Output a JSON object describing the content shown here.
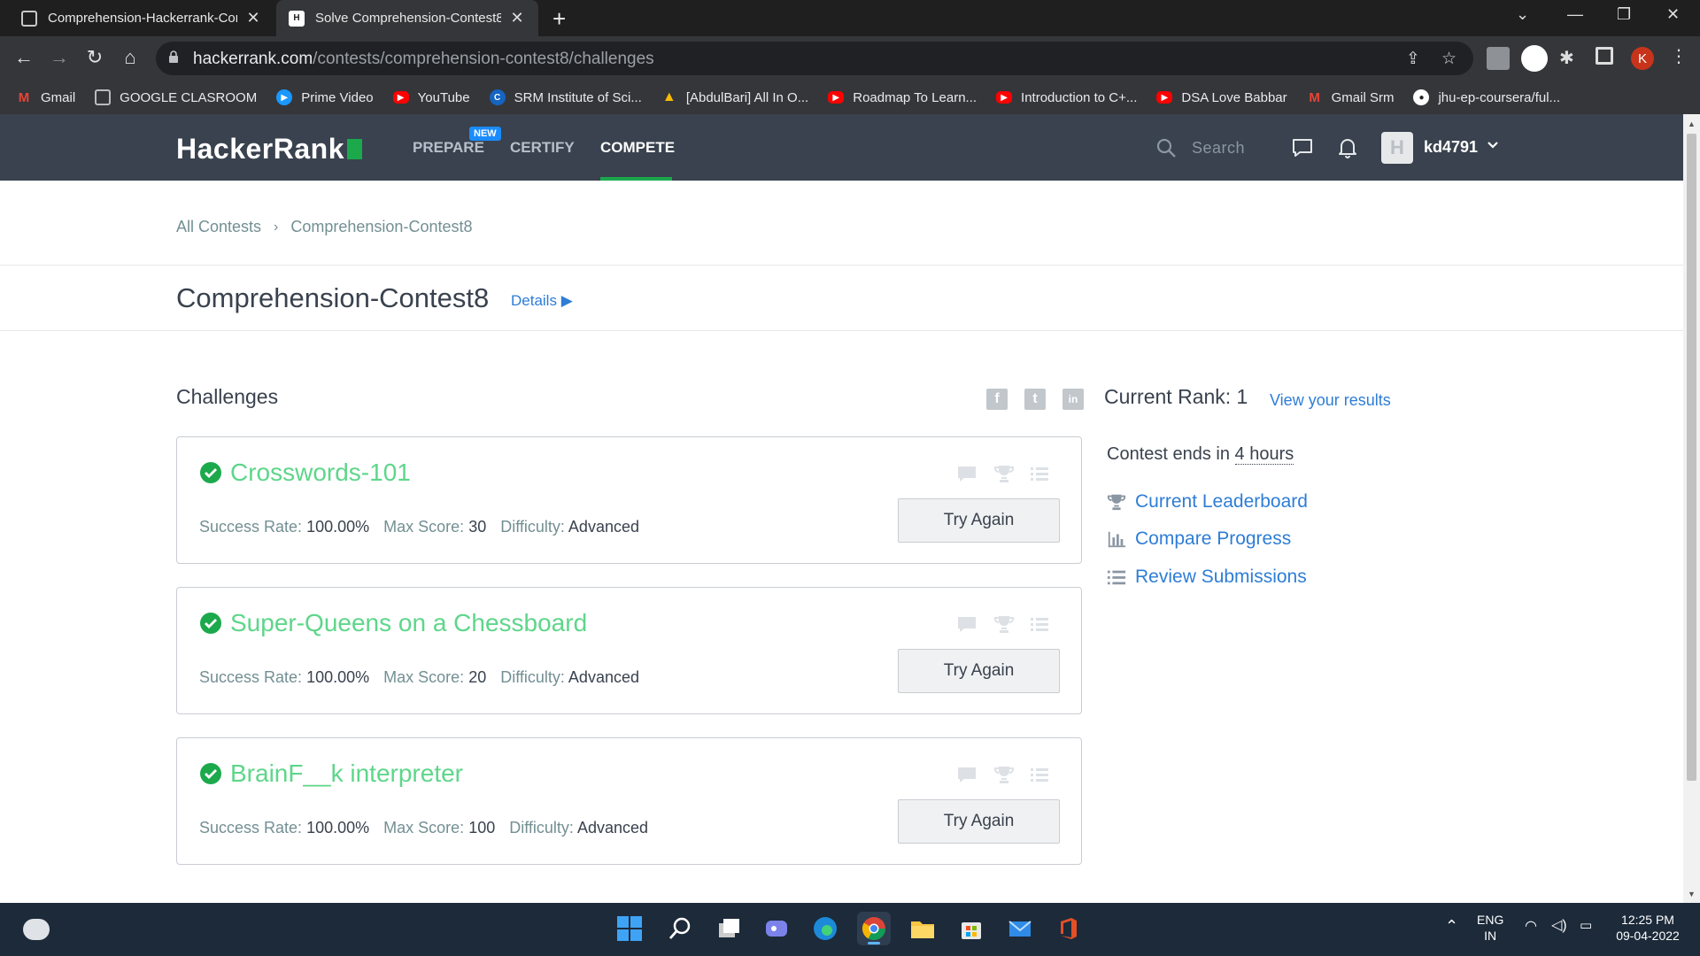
{
  "browser": {
    "tabs": [
      {
        "title": "Comprehension-Hackerrank-Con",
        "active": false,
        "favicon": "classroom-icon"
      },
      {
        "title": "Solve Comprehension-Contest8 (",
        "active": true,
        "favicon": "hackerrank-icon"
      }
    ],
    "url_host": "hackerrank.com",
    "url_path": "/contests/comprehension-contest8/challenges",
    "profile_initial": "K",
    "bookmarks": [
      {
        "label": "Gmail",
        "icon": "gmail-icon",
        "color": "#ea4335"
      },
      {
        "label": "GOOGLE CLASROOM",
        "icon": "classroom-icon",
        "color": "#9e9e9e"
      },
      {
        "label": "Prime Video",
        "icon": "prime-video-icon",
        "color": "#1a98ff"
      },
      {
        "label": "YouTube",
        "icon": "youtube-icon",
        "color": "#ff0000"
      },
      {
        "label": "SRM Institute of Sci...",
        "icon": "srm-icon",
        "color": "#1565c0"
      },
      {
        "label": "[AbdulBari] All In O...",
        "icon": "drive-icon",
        "color": "#fbbc04"
      },
      {
        "label": "Roadmap To Learn...",
        "icon": "youtube-icon",
        "color": "#ff0000"
      },
      {
        "label": "Introduction to C+...",
        "icon": "youtube-icon",
        "color": "#ff0000"
      },
      {
        "label": "DSA Love Babbar",
        "icon": "youtube-icon",
        "color": "#ff0000"
      },
      {
        "label": "Gmail Srm",
        "icon": "gmail-icon",
        "color": "#ea4335"
      },
      {
        "label": "jhu-ep-coursera/ful...",
        "icon": "github-icon",
        "color": "#ffffff"
      }
    ]
  },
  "nav": {
    "logo": "HackerRank",
    "items": [
      {
        "label": "PREPARE",
        "active": false
      },
      {
        "label": "CERTIFY",
        "active": false
      },
      {
        "label": "COMPETE",
        "active": true
      }
    ],
    "new_badge": "NEW",
    "search_placeholder": "Search",
    "avatar_letter": "H",
    "username": "kd4791"
  },
  "breadcrumb": {
    "root": "All Contests",
    "current": "Comprehension-Contest8"
  },
  "contest": {
    "title": "Comprehension-Contest8",
    "details_label": "Details"
  },
  "challenges": {
    "heading": "Challenges",
    "labels": {
      "success": "Success Rate:",
      "max": "Max Score:",
      "difficulty": "Difficulty:",
      "button": "Try Again"
    },
    "items": [
      {
        "name": "Crosswords-101",
        "success_rate": "100.00%",
        "max_score": "30",
        "difficulty": "Advanced",
        "solved": true
      },
      {
        "name": "Super-Queens on a Chessboard",
        "success_rate": "100.00%",
        "max_score": "20",
        "difficulty": "Advanced",
        "solved": true
      },
      {
        "name": "BrainF__k interpreter",
        "success_rate": "100.00%",
        "max_score": "100",
        "difficulty": "Advanced",
        "solved": true
      }
    ]
  },
  "social": [
    {
      "icon": "facebook-icon",
      "glyph": "f"
    },
    {
      "icon": "twitter-icon",
      "glyph": "t"
    },
    {
      "icon": "linkedin-icon",
      "glyph": "in"
    }
  ],
  "sidebar": {
    "rank_text": "Current Rank: 1",
    "view_results": "View your results",
    "ends_prefix": "Contest ends in",
    "ends_duration": "4 hours",
    "links": [
      {
        "label": "Current Leaderboard",
        "icon": "trophy-icon"
      },
      {
        "label": "Compare Progress",
        "icon": "bar-chart-icon"
      },
      {
        "label": "Review Submissions",
        "icon": "list-icon"
      }
    ]
  },
  "taskbar": {
    "lang": "ENG",
    "region": "IN",
    "time": "12:25 PM",
    "date": "09-04-2022"
  },
  "colors": {
    "navbar": "#39424e",
    "accent_green": "#1ba94c",
    "solved_green": "#5ed68a",
    "link_blue": "#2e7dd6"
  }
}
